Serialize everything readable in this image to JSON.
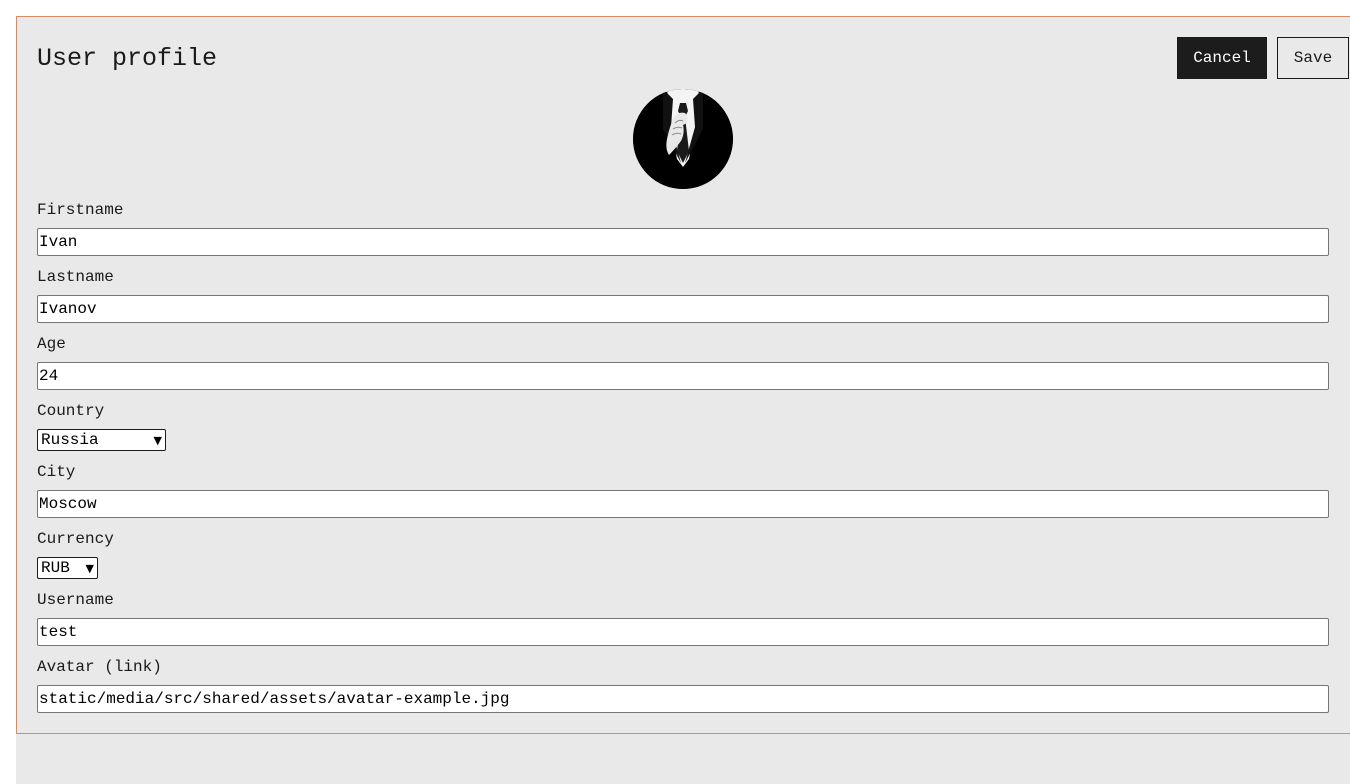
{
  "header": {
    "title": "User profile",
    "cancel_label": "Cancel",
    "save_label": "Save"
  },
  "avatar": {
    "icon": "avatar-suit-icon"
  },
  "form": {
    "firstname": {
      "label": "Firstname",
      "value": "Ivan"
    },
    "lastname": {
      "label": "Lastname",
      "value": "Ivanov"
    },
    "age": {
      "label": "Age",
      "value": "24"
    },
    "country": {
      "label": "Country",
      "value": "Russia"
    },
    "city": {
      "label": "City",
      "value": "Moscow"
    },
    "currency": {
      "label": "Currency",
      "value": "RUB"
    },
    "username": {
      "label": "Username",
      "value": "test"
    },
    "avatar_link": {
      "label": "Avatar (link)",
      "value": "static/media/src/shared/assets/avatar-example.jpg"
    }
  },
  "colors": {
    "card_border": "#d98a66",
    "background": "#e9e9e9",
    "primary_button": "#1c1c1c"
  }
}
